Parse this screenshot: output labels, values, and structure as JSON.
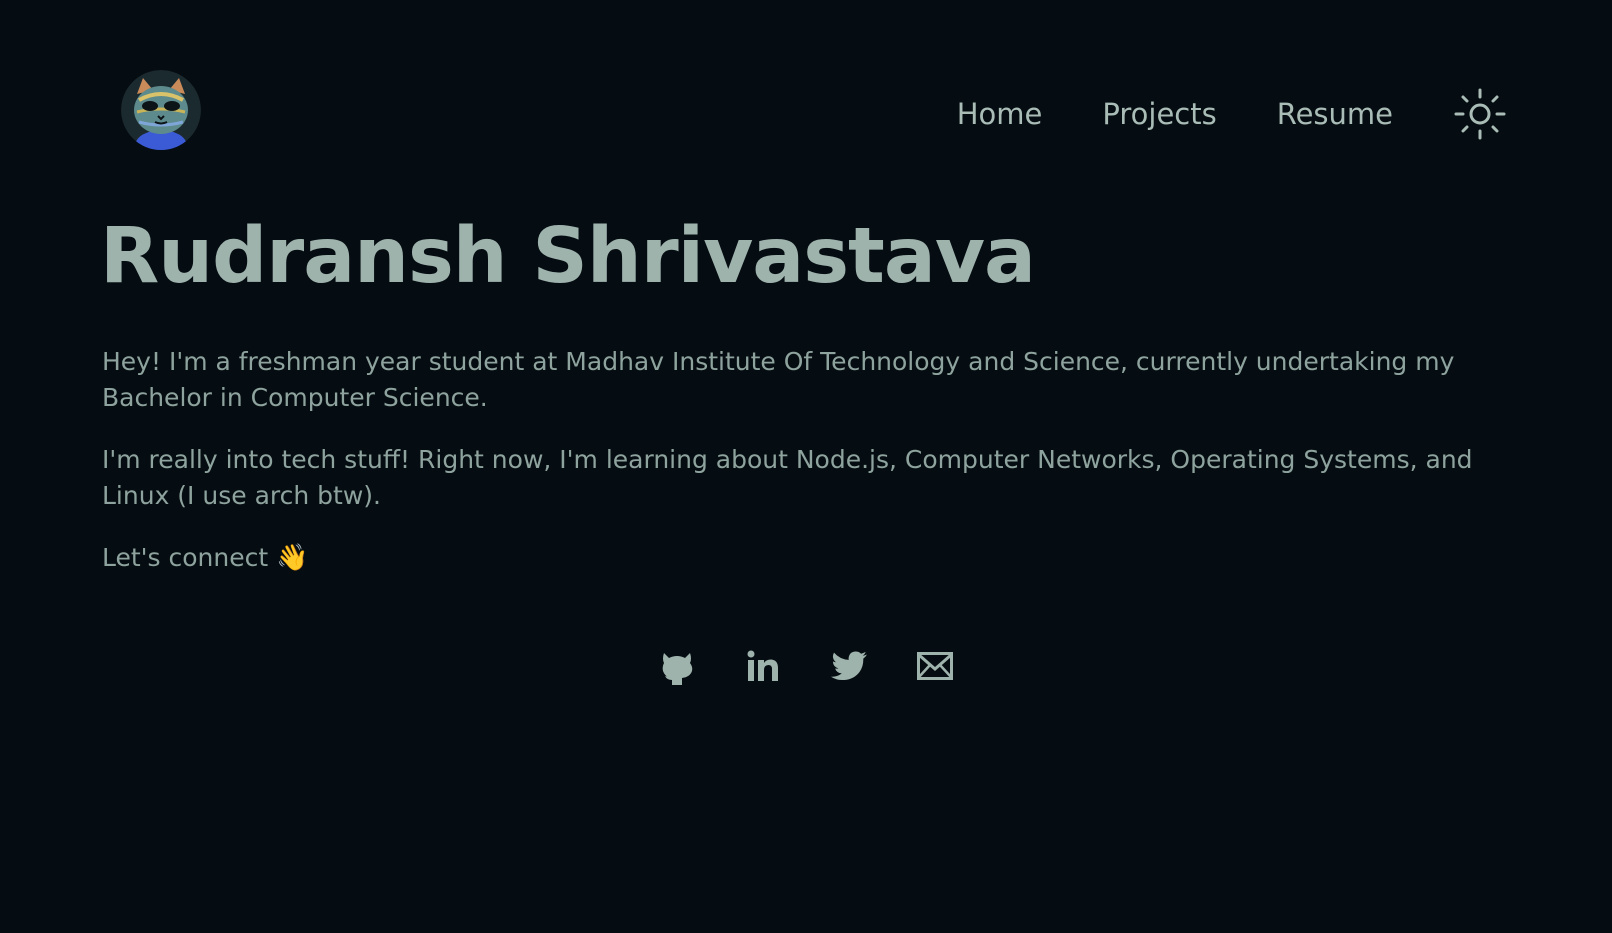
{
  "header": {
    "avatar_alt": "avatar",
    "nav": [
      {
        "label": "Home"
      },
      {
        "label": "Projects"
      },
      {
        "label": "Resume"
      }
    ],
    "theme_toggle_icon": "sun-icon"
  },
  "hero": {
    "name": "Rudransh Shrivastava",
    "bio": [
      "Hey! I'm a freshman year student at Madhav Institute Of Technology and Science, currently undertaking my Bachelor in Computer Science.",
      "I'm really into tech stuff! Right now, I'm learning about Node.js, Computer Networks, Operating Systems, and Linux (I use arch btw).",
      "Let's connect"
    ],
    "wave_emoji": "👋"
  },
  "socials": [
    {
      "icon": "github-icon"
    },
    {
      "icon": "linkedin-icon"
    },
    {
      "icon": "twitter-icon"
    },
    {
      "icon": "mail-icon"
    }
  ],
  "colors": {
    "background": "#060d12",
    "text": "#9fb3ad",
    "muted_text": "#8ea39d"
  }
}
